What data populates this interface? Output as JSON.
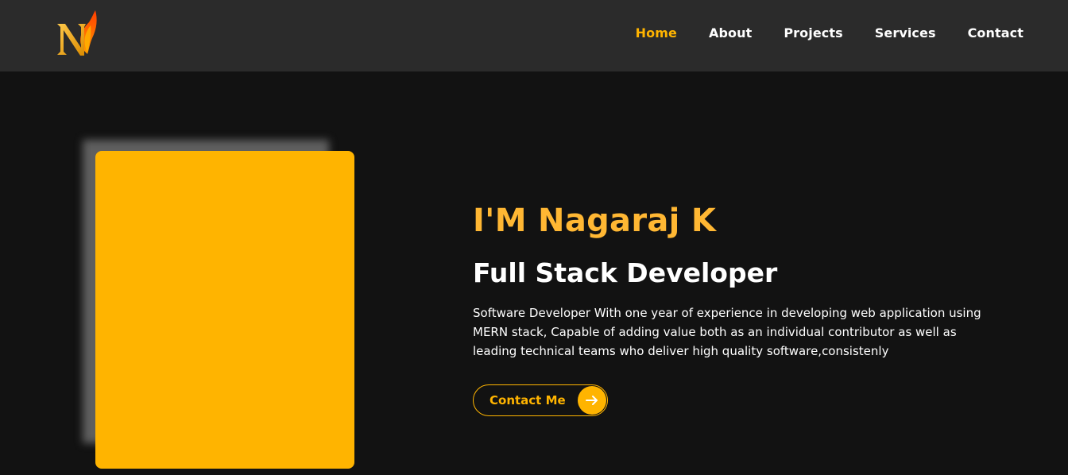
{
  "nav": {
    "logo": "N",
    "links": [
      {
        "label": "Home",
        "active": true
      },
      {
        "label": "About",
        "active": false
      },
      {
        "label": "Projects",
        "active": false
      },
      {
        "label": "Services",
        "active": false
      },
      {
        "label": "Contact",
        "active": false
      }
    ]
  },
  "hero": {
    "name": "I'M Nagaraj K",
    "role": "Full Stack Developer",
    "description": "Software Developer With one year of experience in developing web application using MERN stack, Capable of adding value both as an individual contributor as well as leading technical teams who deliver high quality software,consistenly",
    "cta_label": "Contact Me",
    "cta_icon": "arrow-right-icon"
  },
  "colors": {
    "accent": "#ffb400",
    "navbar_bg": "#2b2b2b",
    "page_bg": "#121212",
    "text": "#ffffff"
  }
}
